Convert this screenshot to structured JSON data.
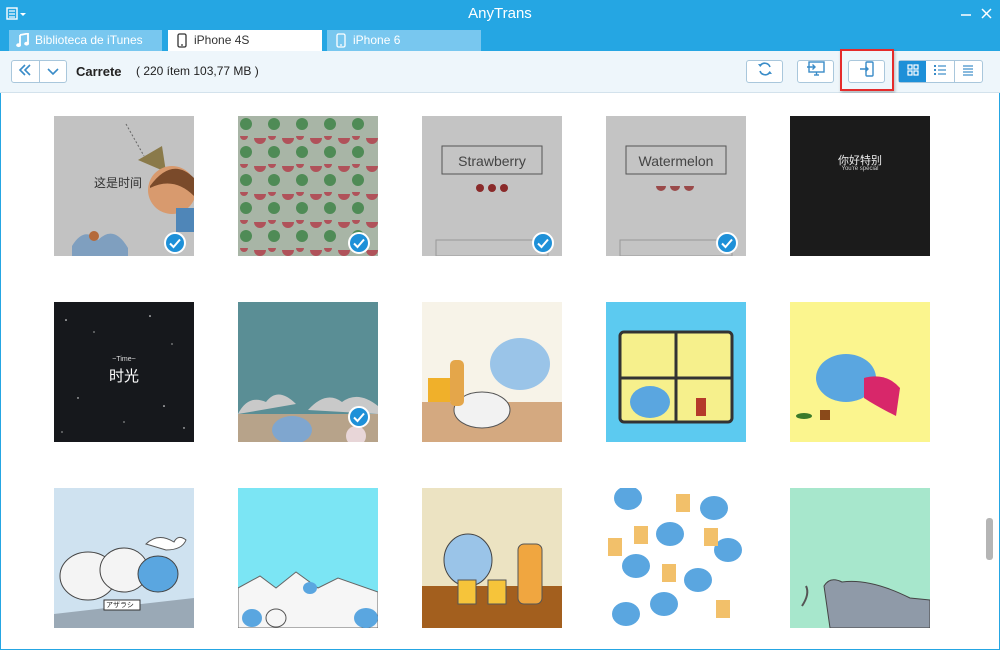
{
  "window": {
    "title": "AnyTrans"
  },
  "tabs": [
    {
      "label": "Biblioteca de iTunes",
      "icon": "music-note-icon"
    },
    {
      "label": "iPhone 4S",
      "icon": "phone-icon"
    },
    {
      "label": "iPhone 6",
      "icon": "phone-icon"
    }
  ],
  "toolbar": {
    "title": "Carrete",
    "count": "( 220 ítem 103,77 MB )",
    "buttons": [
      "refresh-icon",
      "send-to-pc-icon",
      "add-to-device-icon"
    ],
    "views": [
      "grid-view-icon",
      "detail-list-view-icon",
      "list-view-icon"
    ],
    "selected_view": "grid-view-icon"
  },
  "photos": [
    {
      "caption": "这是时间",
      "selected": true
    },
    {
      "caption": "",
      "selected": true
    },
    {
      "caption": "Strawberry",
      "selected": true
    },
    {
      "caption": "Watermelon",
      "selected": true
    },
    {
      "caption": "你好特别",
      "subcaption": "You're special",
      "selected": false
    },
    {
      "caption": "时光",
      "subcaption": "~Time~",
      "selected": false
    },
    {
      "caption": "",
      "selected": true
    },
    {
      "caption": "",
      "selected": false
    },
    {
      "caption": "",
      "selected": false
    },
    {
      "caption": "",
      "selected": false
    },
    {
      "caption": "アザラシ",
      "selected": false
    },
    {
      "caption": "",
      "selected": false
    },
    {
      "caption": "",
      "selected": false
    },
    {
      "caption": "",
      "selected": false
    },
    {
      "caption": "",
      "selected": false
    }
  ],
  "colors": {
    "accent": "#25a6e3",
    "highlight": "#e52b2b",
    "check": "#1e90d8"
  }
}
